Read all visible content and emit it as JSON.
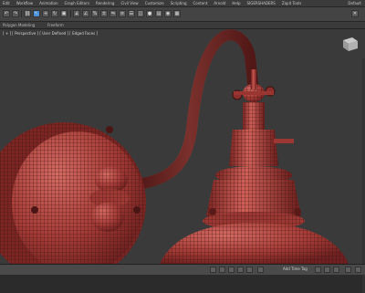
{
  "menu": {
    "items": [
      "Edit",
      "Workflow",
      "Animation",
      "Graph Editors",
      "Rendering",
      "Civil View",
      "Customize",
      "Scripting",
      "Content",
      "Arnold",
      "Help",
      "SIGERSHADERS",
      "Zapit Tools"
    ],
    "workspace": "Default"
  },
  "ribbon": {
    "tabs": [
      "Polygon Modeling",
      "Freeform"
    ]
  },
  "viewport": {
    "label": "[ + ] [ Perspective ] [ User Defined ] [ Edged Faces ]"
  },
  "status": {
    "left": "",
    "add_time_tag": "Add Time Tag",
    "coords": ""
  },
  "colors": {
    "model": "#a03a36",
    "wire": "#3b1614",
    "highlight": "#d86a62",
    "bg": "#3a3a3a"
  }
}
